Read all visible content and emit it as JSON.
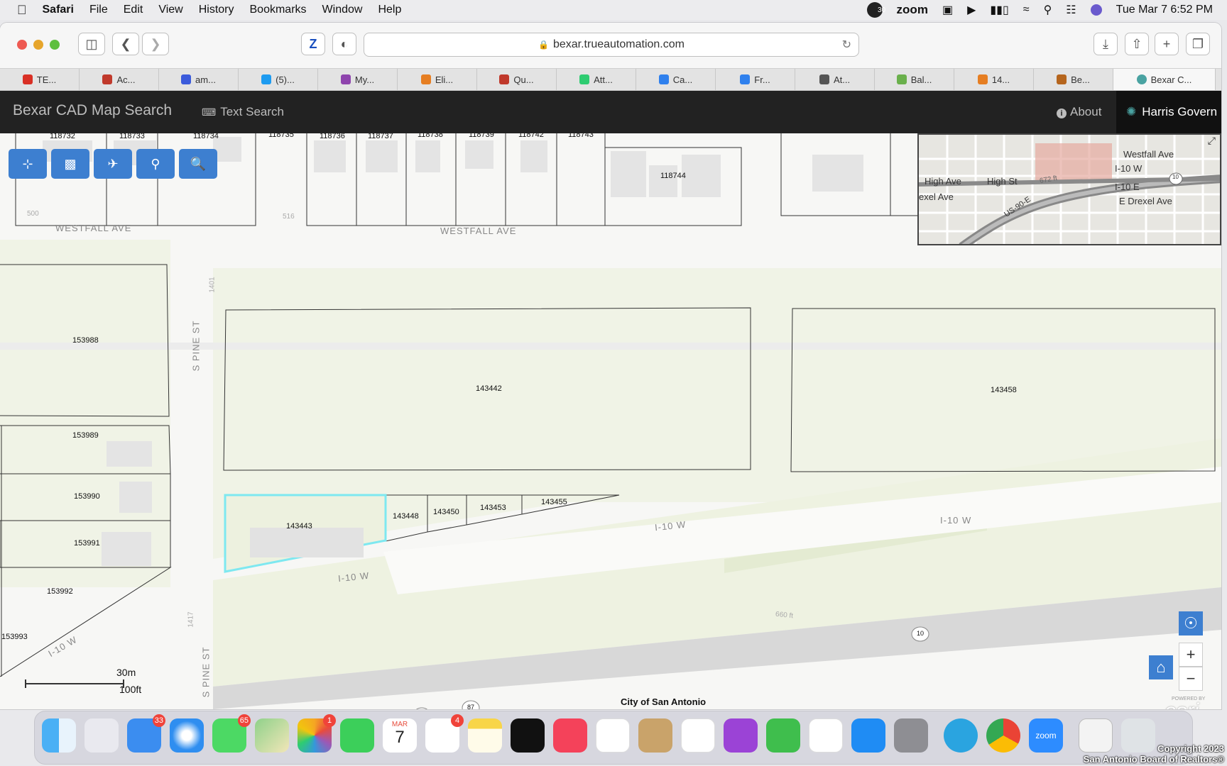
{
  "menubar": {
    "apple": "",
    "app": "Safari",
    "items": [
      "File",
      "Edit",
      "View",
      "History",
      "Bookmarks",
      "Window",
      "Help"
    ],
    "zoom": "zoom",
    "notif_count": "30",
    "datetime": "Tue Mar 7  6:52 PM"
  },
  "browser": {
    "url": "bexar.trueautomation.com",
    "tabs": [
      {
        "label": "TE...",
        "color": "#d93025"
      },
      {
        "label": "Ac...",
        "color": "#c0392b"
      },
      {
        "label": "am...",
        "color": "#3b5bdb"
      },
      {
        "label": "(5)...",
        "color": "#1d9bf0"
      },
      {
        "label": "My...",
        "color": "#8e44ad"
      },
      {
        "label": "Eli...",
        "color": "#e67e22"
      },
      {
        "label": "Qu...",
        "color": "#c0392b"
      },
      {
        "label": "Att...",
        "color": "#2ecc71"
      },
      {
        "label": "Ca...",
        "color": "#2f80ed"
      },
      {
        "label": "Fr...",
        "color": "#2f80ed"
      },
      {
        "label": "At...",
        "color": "#555555"
      },
      {
        "label": "Bal...",
        "color": "#6ab04c"
      },
      {
        "label": "14...",
        "color": "#e67e22"
      },
      {
        "label": "Be...",
        "color": "#b5651d"
      },
      {
        "label": "Bexar C...",
        "color": "#4aa3a2"
      }
    ]
  },
  "app": {
    "title": "Bexar CAD Map Search",
    "text_search": "Text Search",
    "about": "About",
    "harris": "Harris Govern"
  },
  "map": {
    "top_parcels": [
      "118732",
      "118733",
      "118734",
      "118735",
      "118736",
      "118737",
      "118738",
      "118739",
      "118742",
      "118743",
      "118744"
    ],
    "addr_500": "500",
    "addr_516": "516",
    "westfall_left": "WESTFALL AVE",
    "westfall_right": "WESTFALL AVE",
    "pine_st_top": "S PINE ST",
    "pine_st_bottom": "S PINE ST",
    "addr_1401": "1401",
    "addr_1417": "1417",
    "parcels_left": [
      "153988",
      "153989",
      "153990",
      "153991",
      "153992",
      "153993"
    ],
    "parcel_big_a": "143442",
    "parcel_big_b": "143458",
    "parcel_selected": "143443",
    "parcels_strip": [
      "143448",
      "143450",
      "143453",
      "143455"
    ],
    "i10_a": "I-10 W",
    "i10_b": "I-10 W",
    "i10_c": "I-10 W",
    "i10_d": "I-10 W",
    "dist_660": "660 ft",
    "city": "City of San Antonio",
    "scale_m": "30m",
    "scale_ft": "100ft",
    "shield_10": "10",
    "shield_87": "87",
    "esri": "esri",
    "powered": "POWERED BY",
    "overview": {
      "westfall": "Westfall Ave",
      "i10w": "I-10 W",
      "i10e": "I-10 E",
      "high_ave": "High Ave",
      "high_st": "High St",
      "exel_ave": "exel Ave",
      "us90": "US-90-E",
      "ft672": "672 ft",
      "drexel": "E Drexel Ave",
      "shield": "10"
    }
  },
  "dock": {
    "mail_badge": "33",
    "messages_badge": "65",
    "photos_badge": "1",
    "reminders_badge": "4",
    "cal_month": "MAR",
    "cal_day": "7",
    "zoom_label": "zoom"
  },
  "watermark": {
    "line1": "Copyright 2023",
    "line2": "San Antonio Board of Realtors®"
  }
}
